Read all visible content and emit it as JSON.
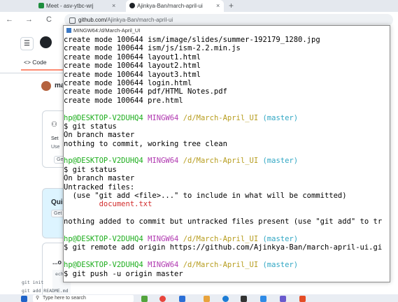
{
  "browser": {
    "tabs": [
      {
        "label": "Meet - asv-ytbc-wrj",
        "active": false,
        "close": "×"
      },
      {
        "label": "Ajinkya-Ban/march-april-ui",
        "active": true,
        "close": "×"
      }
    ],
    "new_tab": "+",
    "nav": {
      "back": "←",
      "forward": "→",
      "reload": "C"
    },
    "url_host": "github.com/",
    "url_path": "Ajinkya-Ban/march-april-ui"
  },
  "github": {
    "menu_icon": "☰",
    "tab_code": "<> Code",
    "user_partial": "ma",
    "box1_texts": [
      "Set",
      "Use",
      "Get"
    ],
    "box2_texts": [
      "Qui",
      "Get"
    ],
    "code_partial": "...o",
    "snippet_lines": [
      "ech",
      "git init",
      "git add README.md"
    ]
  },
  "terminal": {
    "title": "MINGW64:/d/March-April_UI",
    "lines": [
      [
        {
          "t": "create mode 100644 ism/image/slides/summer-192179_1280.jpg"
        }
      ],
      [
        {
          "t": "create mode 100644 ism/js/ism-2.2.min.js"
        }
      ],
      [
        {
          "t": "create mode 100644 layout1.html"
        }
      ],
      [
        {
          "t": "create mode 100644 layout2.html"
        }
      ],
      [
        {
          "t": "create mode 100644 layout3.html"
        }
      ],
      [
        {
          "t": "create mode 100644 login.html"
        }
      ],
      [
        {
          "t": "create mode 100644 pdf/HTML Notes.pdf"
        }
      ],
      [
        {
          "t": "create mode 100644 pre.html"
        }
      ],
      [
        {
          "t": ""
        }
      ],
      [
        {
          "t": "hp@DESKTOP-V2DUHQ4 ",
          "c": "g"
        },
        {
          "t": "MINGW64 ",
          "c": "m"
        },
        {
          "t": "/d/March-April_UI ",
          "c": "y"
        },
        {
          "t": "(master)",
          "c": "c"
        }
      ],
      [
        {
          "t": "$ git status"
        }
      ],
      [
        {
          "t": "On branch master"
        }
      ],
      [
        {
          "t": "nothing to commit, working tree clean"
        }
      ],
      [
        {
          "t": ""
        }
      ],
      [
        {
          "t": "hp@DESKTOP-V2DUHQ4 ",
          "c": "g"
        },
        {
          "t": "MINGW64 ",
          "c": "m"
        },
        {
          "t": "/d/March-April_UI ",
          "c": "y"
        },
        {
          "t": "(master)",
          "c": "c"
        }
      ],
      [
        {
          "t": "$ git status"
        }
      ],
      [
        {
          "t": "On branch master"
        }
      ],
      [
        {
          "t": "Untracked files:"
        }
      ],
      [
        {
          "t": "  (use \"git add <file>...\" to include in what will be committed)"
        }
      ],
      [
        {
          "t": "        document.txt",
          "c": "r"
        }
      ],
      [
        {
          "t": ""
        }
      ],
      [
        {
          "t": "nothing added to commit but untracked files present (use \"git add\" to tr"
        }
      ],
      [
        {
          "t": ""
        }
      ],
      [
        {
          "t": "hp@DESKTOP-V2DUHQ4 ",
          "c": "g"
        },
        {
          "t": "MINGW64 ",
          "c": "m"
        },
        {
          "t": "/d/March-April_UI ",
          "c": "y"
        },
        {
          "t": "(master)",
          "c": "c"
        }
      ],
      [
        {
          "t": "$ git remote add origin https://github.com/Ajinkya-Ban/march-april-ui.gi"
        }
      ],
      [
        {
          "t": ""
        }
      ],
      [
        {
          "t": "hp@DESKTOP-V2DUHQ4 ",
          "c": "g"
        },
        {
          "t": "MINGW64 ",
          "c": "m"
        },
        {
          "t": "/d/March-April_UI ",
          "c": "y"
        },
        {
          "t": "(master)",
          "c": "c"
        }
      ],
      [
        {
          "t": "$ git push -u origin master"
        }
      ]
    ]
  },
  "taskbar": {
    "search_placeholder": "Type here to search",
    "colors": {
      "prompt_user": "#1cad1c",
      "prompt_shell": "#b13ab1",
      "prompt_path": "#b79d1f",
      "prompt_branch": "#31a7c4",
      "untracked": "#d22c2c"
    }
  }
}
